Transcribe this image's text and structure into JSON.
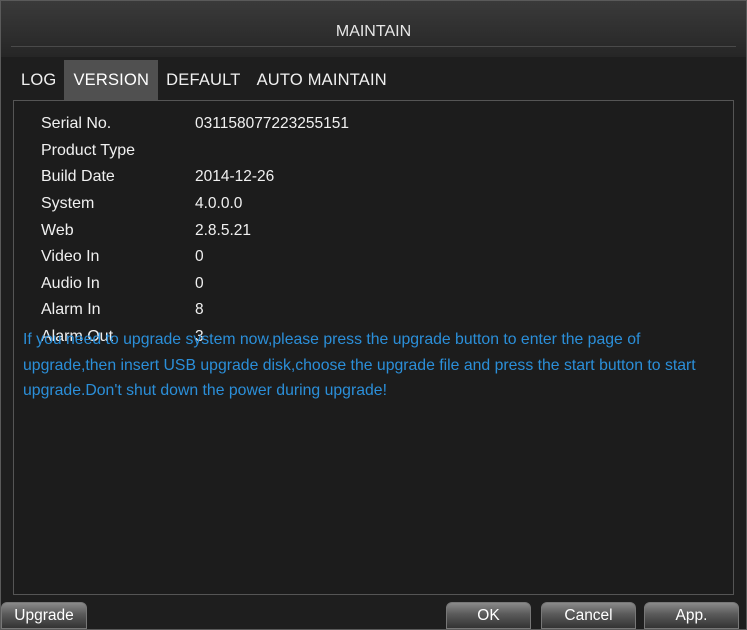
{
  "window": {
    "title": "MAINTAIN"
  },
  "tabs": [
    {
      "label": "LOG"
    },
    {
      "label": "VERSION",
      "active": true
    },
    {
      "label": "DEFAULT"
    },
    {
      "label": "AUTO MAINTAIN"
    }
  ],
  "info": {
    "serial_no": {
      "label": "Serial No.",
      "value": "031158077223255151"
    },
    "product_type": {
      "label": "Product Type",
      "value": ""
    },
    "build_date": {
      "label": "Build Date",
      "value": "2014-12-26"
    },
    "system": {
      "label": "System",
      "value": "4.0.0.0"
    },
    "web": {
      "label": "Web",
      "value": "2.8.5.21"
    },
    "video_in": {
      "label": "Video In",
      "value": "0"
    },
    "audio_in": {
      "label": "Audio In",
      "value": "0"
    },
    "alarm_in": {
      "label": "Alarm In",
      "value": "8"
    },
    "alarm_out": {
      "label": "Alarm Out",
      "value": "3"
    }
  },
  "notice": "If you need to upgrade system now,please press the upgrade button to enter the page of upgrade,then insert USB upgrade disk,choose the upgrade file and press the start button to start upgrade.Don't shut down the power during upgrade!",
  "buttons": {
    "upgrade": "Upgrade",
    "ok": "OK",
    "cancel": "Cancel",
    "apply": "App."
  },
  "colors": {
    "notice_text": "#2b8fd9",
    "background": "#1e1e1e",
    "active_tab": "#505050"
  }
}
